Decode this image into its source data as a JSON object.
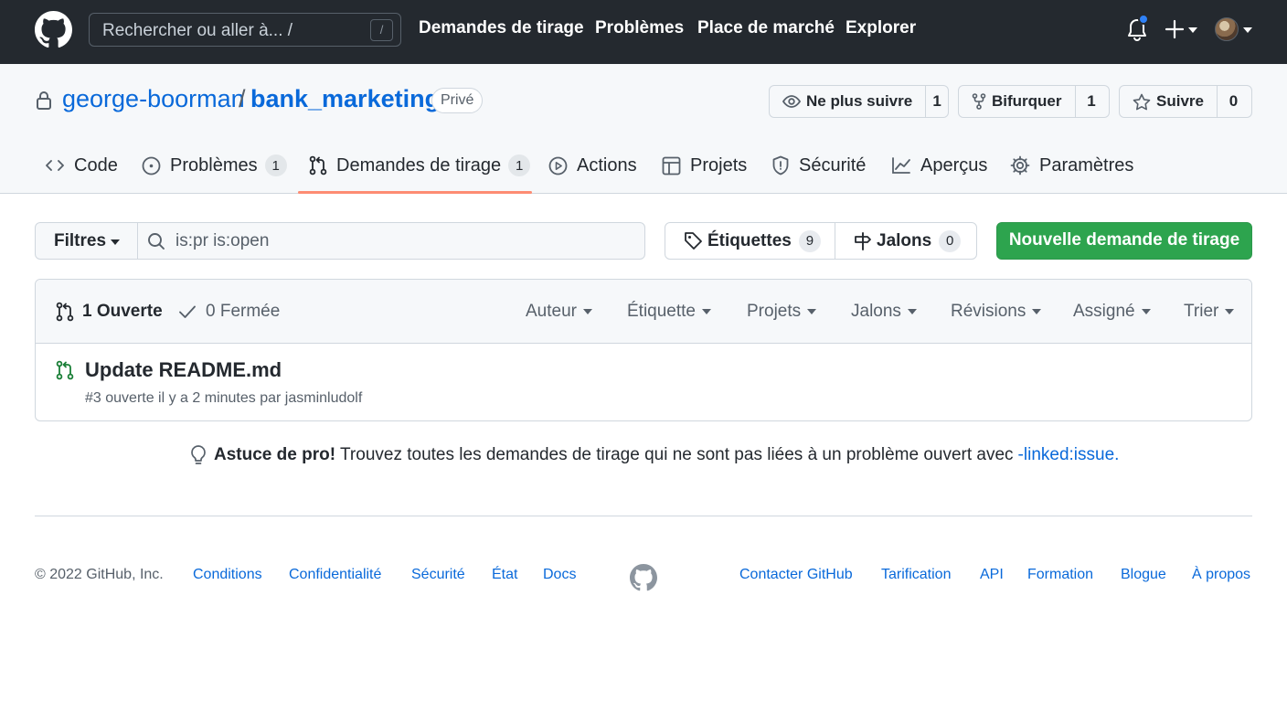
{
  "header": {
    "search_placeholder": "Rechercher ou aller à... /",
    "search_key": "/",
    "nav": [
      "Demandes de tirage",
      "Problèmes",
      "Place de marché",
      "Explorer"
    ]
  },
  "repo": {
    "owner": "george-boorman",
    "separator": "/",
    "name": "bank_marketing",
    "visibility": "Privé",
    "watch": {
      "label": "Ne plus suivre",
      "count": "1"
    },
    "fork": {
      "label": "Bifurquer",
      "count": "1"
    },
    "star": {
      "label": "Suivre",
      "count": "0"
    }
  },
  "tabs": [
    {
      "label": "Code"
    },
    {
      "label": "Problèmes",
      "count": "1"
    },
    {
      "label": "Demandes de tirage",
      "count": "1"
    },
    {
      "label": "Actions"
    },
    {
      "label": "Projets"
    },
    {
      "label": "Sécurité"
    },
    {
      "label": "Aperçus"
    },
    {
      "label": "Paramètres"
    }
  ],
  "toolbar": {
    "filters_label": "Filtres",
    "query": "is:pr is:open",
    "labels_label": "Étiquettes",
    "labels_count": "9",
    "milestones_label": "Jalons",
    "milestones_count": "0",
    "new_pr_label": "Nouvelle demande de tirage"
  },
  "list": {
    "open_label": "1 Ouverte",
    "closed_label": "0 Fermée",
    "sort_menus": [
      "Auteur",
      "Étiquette",
      "Projets",
      "Jalons",
      "Révisions",
      "Assigné",
      "Trier"
    ],
    "items": [
      {
        "title": "Update README.md",
        "meta": "#3 ouverte il y a 2 minutes par jasminludolf"
      }
    ]
  },
  "tip": {
    "strong": "Astuce de pro!",
    "text": "Trouvez toutes les demandes de tirage qui ne sont pas liées à un problème ouvert avec",
    "link": "-linked:issue."
  },
  "footer": {
    "copyright": "© 2022 GitHub, Inc.",
    "left_links": [
      "Conditions",
      "Confidentialité",
      "Sécurité",
      "État",
      "Docs"
    ],
    "right_links": [
      "Contacter GitHub",
      "Tarification",
      "API",
      "Formation",
      "Blogue",
      "À propos"
    ]
  },
  "colors": {
    "header_bg": "#24292f",
    "link": "#0969da",
    "primary_button": "#2da44e",
    "open_icon": "#1a7f37",
    "tab_underline": "#fd8c73"
  }
}
